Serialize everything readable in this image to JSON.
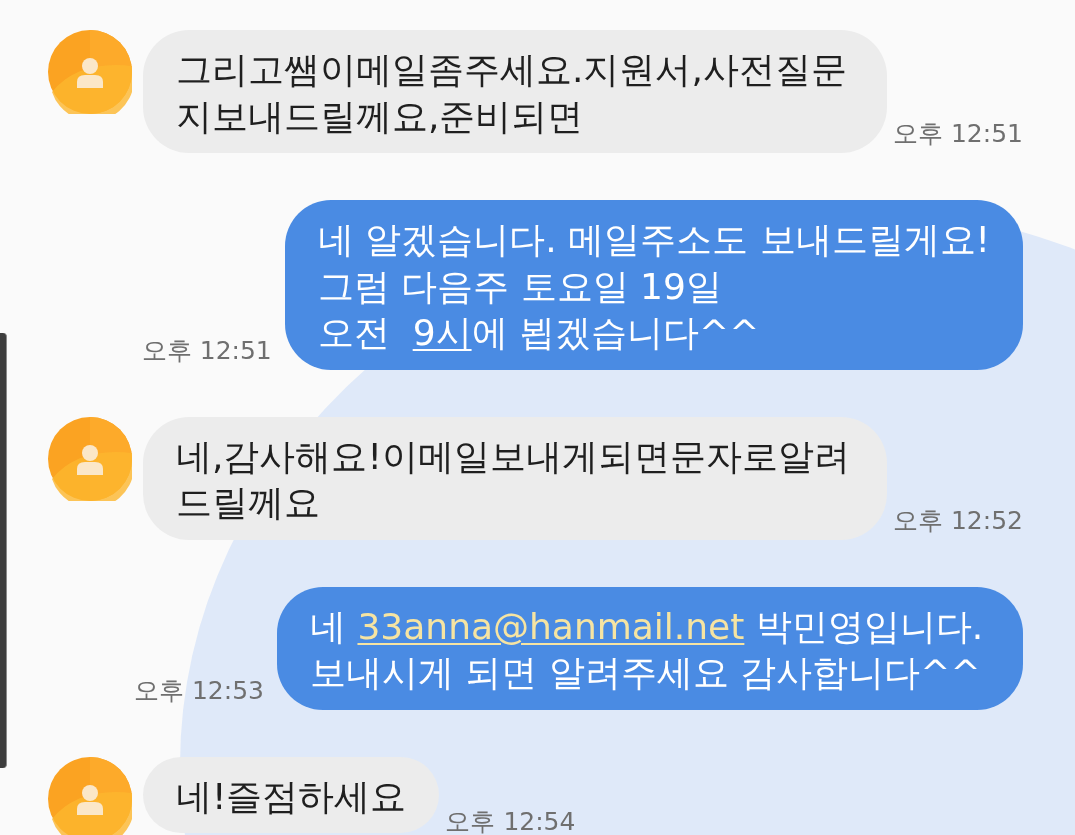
{
  "messages": [
    {
      "kind": "received",
      "parts": [
        {
          "kind": "text",
          "text": "그리고쌤이메일좀주세요.지원서,사전질문지보내드릴께요,준비되면"
        }
      ],
      "time": "오후 12:51"
    },
    {
      "kind": "sent",
      "parts": [
        {
          "kind": "text",
          "text": "네 알겠습니다. 메일주소도 보내드릴게요!\n그럼 다음주 토요일 19일\n오전  "
        },
        {
          "kind": "date",
          "text": "9시"
        },
        {
          "kind": "text",
          "text": "에 뵙겠습니다^^"
        }
      ],
      "time": "오후 12:51"
    },
    {
      "kind": "received",
      "parts": [
        {
          "kind": "text",
          "text": "네,감사해요!이메일보내게되면문자로알려드릴께요"
        }
      ],
      "time": "오후 12:52"
    },
    {
      "kind": "sent",
      "parts": [
        {
          "kind": "text",
          "text": "네 "
        },
        {
          "kind": "email",
          "text": "33anna@hanmail.net"
        },
        {
          "kind": "text",
          "text": " 박민영입니다. 보내시게 되면 알려주세요 감사합니다^^"
        }
      ],
      "time": "오후 12:53"
    },
    {
      "kind": "received",
      "parts": [
        {
          "kind": "text",
          "text": "네!즐점하세요"
        }
      ],
      "time": "오후 12:54"
    }
  ]
}
